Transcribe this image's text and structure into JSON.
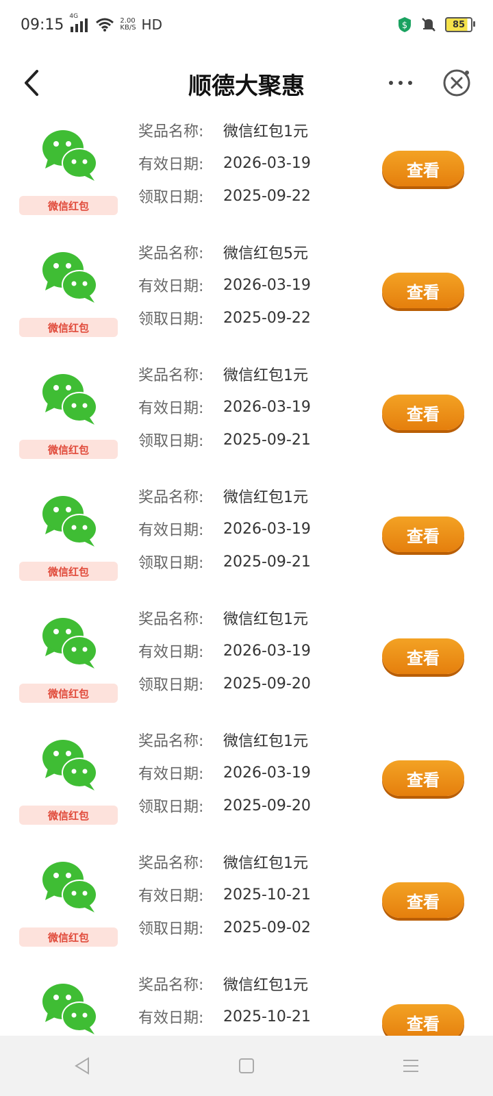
{
  "status_bar": {
    "time": "09:15",
    "network": "4G",
    "speed_value": "2.00",
    "speed_unit": "KB/S",
    "hd": "HD",
    "battery": "85"
  },
  "header": {
    "title": "顺德大聚惠"
  },
  "labels": {
    "prize_name": "奖品名称:",
    "valid_date": "有效日期:",
    "claim_date": "领取日期:",
    "thumb_label": "微信红包",
    "view_button": "查看"
  },
  "items": [
    {
      "name": "微信红包1元",
      "valid": "2026-03-19",
      "claimed": "2025-09-22"
    },
    {
      "name": "微信红包5元",
      "valid": "2026-03-19",
      "claimed": "2025-09-22"
    },
    {
      "name": "微信红包1元",
      "valid": "2026-03-19",
      "claimed": "2025-09-21"
    },
    {
      "name": "微信红包1元",
      "valid": "2026-03-19",
      "claimed": "2025-09-21"
    },
    {
      "name": "微信红包1元",
      "valid": "2026-03-19",
      "claimed": "2025-09-20"
    },
    {
      "name": "微信红包1元",
      "valid": "2026-03-19",
      "claimed": "2025-09-20"
    },
    {
      "name": "微信红包1元",
      "valid": "2025-10-21",
      "claimed": "2025-09-02"
    },
    {
      "name": "微信红包1元",
      "valid": "2025-10-21",
      "claimed": ""
    }
  ],
  "colors": {
    "accent": "#e98a14",
    "wechat_green": "#3fbd34",
    "label_bg": "#fde2dc",
    "label_text": "#e04a3a"
  },
  "icons": {
    "back": "chevron-left-icon",
    "more": "more-dots-icon",
    "close": "close-circle-icon",
    "wechat": "wechat-icon",
    "nav_back": "triangle-back-icon",
    "nav_home": "square-home-icon",
    "nav_menu": "menu-lines-icon"
  }
}
